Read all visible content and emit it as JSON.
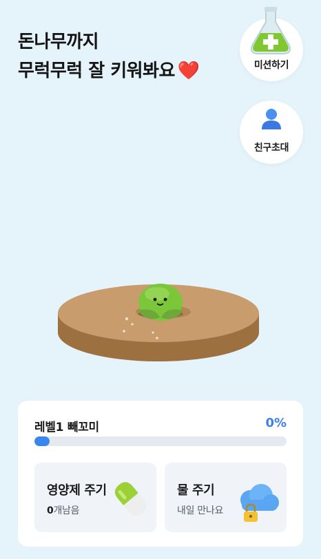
{
  "headline": {
    "line1": "돈나무까지",
    "line2": "무럭무럭 잘 키워봐요",
    "emoji": "❤️"
  },
  "side_buttons": {
    "mission_label": "미션하기",
    "invite_label": "친구초대"
  },
  "progress": {
    "level_label": "레벨1 빼꼬미",
    "percent_label": "0%",
    "percent_value": 0
  },
  "cards": {
    "nutrient": {
      "title": "영양제 주기",
      "count": "0",
      "count_suffix": "개남음"
    },
    "water": {
      "title": "물 주기",
      "subtitle": "내일 만나요"
    }
  },
  "colors": {
    "background": "#e5f3fa",
    "accent": "#3a86ee",
    "card": "#f0f4f9"
  },
  "icons": [
    "flask-icon",
    "person-icon",
    "seed-character-icon",
    "pill-icon",
    "cloud-icon",
    "lock-icon"
  ]
}
